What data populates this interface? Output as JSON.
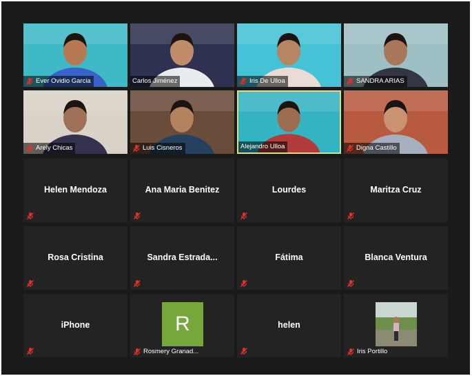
{
  "meeting": {
    "participants": [
      {
        "name": "Ever Ovidio Garcia",
        "kind": "video",
        "muted": true,
        "bg": "#3fb9c6",
        "skin": "#b57a54",
        "shirt": "#3a63c7"
      },
      {
        "name": "Carlos Jiménez",
        "kind": "video",
        "muted": false,
        "bg": "#2e3150",
        "skin": "#c08c6a",
        "shirt": "#e9ecef"
      },
      {
        "name": "Iris De Ulloa",
        "kind": "video",
        "muted": true,
        "bg": "#46c2d6",
        "skin": "#b68564",
        "shirt": "#e8dcd4"
      },
      {
        "name": "SANDRA ARIAS",
        "kind": "video",
        "muted": true,
        "bg": "#9ebfc4",
        "skin": "#a9785a",
        "shirt": "#333744"
      },
      {
        "name": "Arely Chicas",
        "kind": "video",
        "muted": true,
        "bg": "#d9d2c8",
        "skin": "#9f7058",
        "shirt": "#36324e"
      },
      {
        "name": "Luis Cisneros",
        "kind": "video",
        "muted": true,
        "bg": "#6a4c3b",
        "skin": "#b3825f",
        "shirt": "#26405f"
      },
      {
        "name": "Alejandro Ulloa",
        "kind": "video",
        "muted": false,
        "active": true,
        "bg": "#34b3c2",
        "skin": "#9d6c4e",
        "shirt": "#b23b3b"
      },
      {
        "name": "Digna Castillo",
        "kind": "video",
        "muted": true,
        "bg": "#b85a40",
        "skin": "#c99273",
        "shirt": "#a7b0bf"
      },
      {
        "name": "Helen Mendoza",
        "kind": "name",
        "muted": true
      },
      {
        "name": "Ana Maria Benitez",
        "kind": "name",
        "muted": true
      },
      {
        "name": "Lourdes",
        "kind": "name",
        "muted": true
      },
      {
        "name": "Maritza Cruz",
        "kind": "name",
        "muted": true
      },
      {
        "name": "Rosa Cristina",
        "kind": "name",
        "muted": true
      },
      {
        "name": "Sandra  Estrada...",
        "kind": "name",
        "muted": true
      },
      {
        "name": "Fátima",
        "kind": "name",
        "muted": true
      },
      {
        "name": "Blanca Ventura",
        "kind": "name",
        "muted": true
      },
      {
        "name": "iPhone",
        "kind": "name",
        "muted": true
      },
      {
        "name": "Rosmery Granad...",
        "kind": "letter",
        "letter": "R",
        "muted": true
      },
      {
        "name": "helen",
        "kind": "name",
        "muted": true
      },
      {
        "name": "Iris Portillo",
        "kind": "photo",
        "muted": true
      }
    ]
  },
  "colors": {
    "background": "#1a1a1a",
    "tile": "#232323",
    "active_border": "#d9e08a",
    "muted_icon": "#e0302b",
    "avatar_green": "#77a73b"
  },
  "icons": {
    "muted": "microphone-muted-icon"
  }
}
